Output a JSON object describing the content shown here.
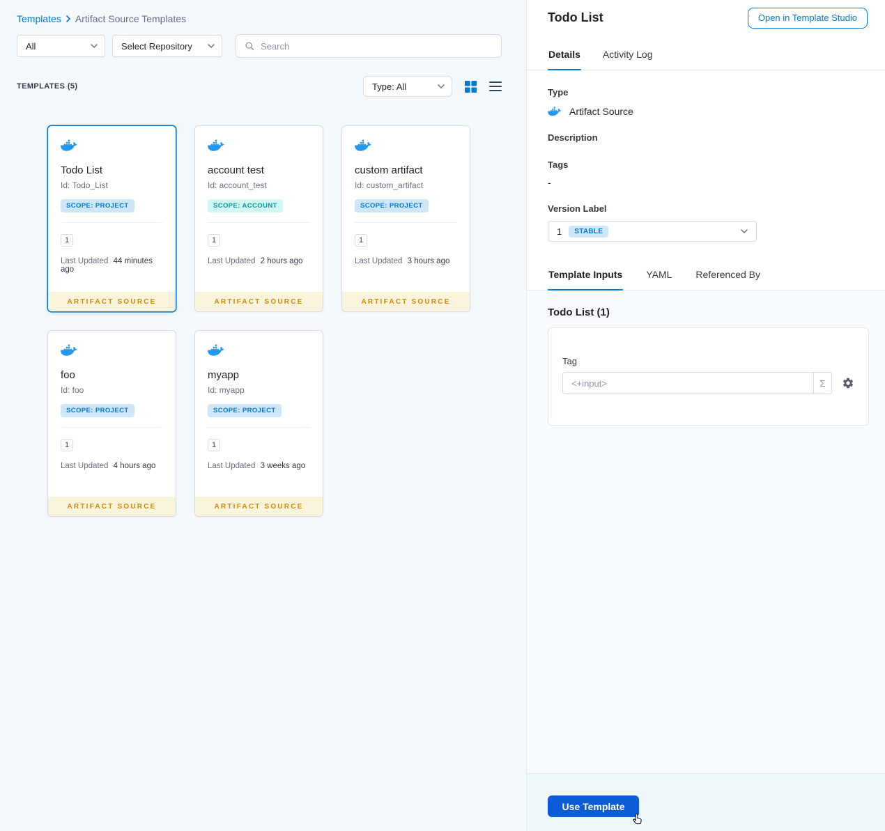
{
  "breadcrumb": {
    "root": "Templates",
    "current": "Artifact Source Templates"
  },
  "filters": {
    "scope": "All",
    "repository": "Select Repository",
    "search_placeholder": "Search"
  },
  "list_header": {
    "count": "TEMPLATES (5)",
    "type_filter": "Type: All"
  },
  "labels": {
    "last_updated": "Last Updated"
  },
  "cards": [
    {
      "title": "Todo List",
      "id": "Id: Todo_List",
      "scope": "SCOPE: PROJECT",
      "version": "1",
      "updated": "44 minutes ago",
      "footer": "ARTIFACT SOURCE"
    },
    {
      "title": "account test",
      "id": "Id: account_test",
      "scope": "SCOPE: ACCOUNT",
      "version": "1",
      "updated": "2 hours ago",
      "footer": "ARTIFACT SOURCE"
    },
    {
      "title": "custom artifact",
      "id": "Id: custom_artifact",
      "scope": "SCOPE: PROJECT",
      "version": "1",
      "updated": "3 hours ago",
      "footer": "ARTIFACT SOURCE"
    },
    {
      "title": "foo",
      "id": "Id: foo",
      "scope": "SCOPE: PROJECT",
      "version": "1",
      "updated": "4 hours ago",
      "footer": "ARTIFACT SOURCE"
    },
    {
      "title": "myapp",
      "id": "Id: myapp",
      "scope": "SCOPE: PROJECT",
      "version": "1",
      "updated": "3 weeks ago",
      "footer": "ARTIFACT SOURCE"
    }
  ],
  "panel": {
    "title": "Todo List",
    "open_in_studio": "Open in Template Studio",
    "tabs": {
      "details": "Details",
      "activity_log": "Activity Log"
    },
    "details": {
      "type_label": "Type",
      "type_value": "Artifact Source",
      "description_label": "Description",
      "tags_label": "Tags",
      "tags_value": "-",
      "version_label": "Version Label",
      "version_value": "1",
      "version_badge": "STABLE"
    },
    "inner_tabs": {
      "template_inputs": "Template Inputs",
      "yaml": "YAML",
      "referenced_by": "Referenced By"
    },
    "inputs": {
      "heading": "Todo List (1)",
      "tag_label": "Tag",
      "tag_placeholder": "<+input>",
      "expression_symbol": "Σ"
    },
    "use_template": "Use Template"
  },
  "colors": {
    "accent": "#0278d5",
    "docker_icon": "#2396ed",
    "scope_project_bg": "#cde7f9",
    "scope_project_text": "#0278d5",
    "scope_account_bg": "#d2f6f1",
    "scope_account_text": "#089aa2",
    "artifact_source_text": "#cf8905",
    "artifact_source_bg": "#fbf4dd",
    "stable_badge_bg": "#cde7f9",
    "stable_badge_text": "#0278d5",
    "primary_button_bg": "#0b5cd6",
    "left_pane_bg": "#f3f9fc"
  }
}
